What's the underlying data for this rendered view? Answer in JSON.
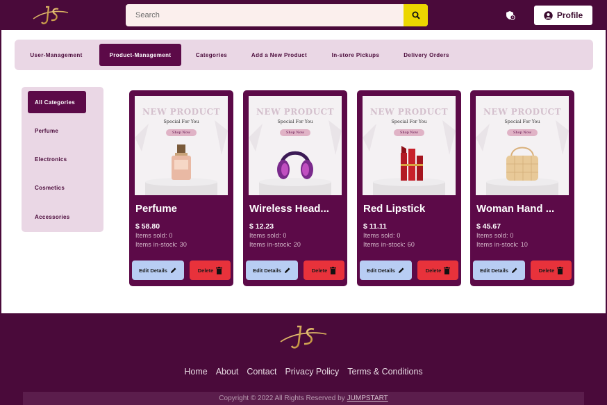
{
  "header": {
    "search_placeholder": "Search",
    "profile_label": "Profile"
  },
  "nav": {
    "tabs": [
      {
        "label": "User-Management",
        "active": false
      },
      {
        "label": "Product-Management",
        "active": true
      },
      {
        "label": "Categories",
        "active": false
      },
      {
        "label": "Add a New Product",
        "active": false
      },
      {
        "label": "In-store Pickups",
        "active": false
      },
      {
        "label": "Delivery Orders",
        "active": false
      }
    ]
  },
  "sidebar": {
    "items": [
      {
        "label": "All Categories",
        "active": true
      },
      {
        "label": "Perfume",
        "active": false
      },
      {
        "label": "Electronics",
        "active": false
      },
      {
        "label": "Cosmetics",
        "active": false
      },
      {
        "label": "Accessories",
        "active": false
      }
    ]
  },
  "product_image": {
    "banner": "NEW PRODUCT",
    "subtitle": "Special For You",
    "pill": "Shop Now"
  },
  "products": [
    {
      "name": "Perfume",
      "price": "$ 58.80",
      "sold": "Items sold: 0",
      "stock": "Items in-stock: 30",
      "icon": "perfume-bottle"
    },
    {
      "name": "Wireless Head...",
      "price": "$ 12.23",
      "sold": "Items sold: 0",
      "stock": "Items in-stock: 20",
      "icon": "headphones"
    },
    {
      "name": "Red Lipstick",
      "price": "$ 11.11",
      "sold": "Items sold: 0",
      "stock": "Items in-stock: 60",
      "icon": "lipstick"
    },
    {
      "name": "Woman Hand ...",
      "price": "$ 45.67",
      "sold": "Items sold: 0",
      "stock": "Items in-stock: 10",
      "icon": "handbag"
    }
  ],
  "card_actions": {
    "edit_label": "Edit Details",
    "delete_label": "Delete"
  },
  "footer": {
    "links": [
      "Home",
      "About",
      "Contact",
      "Privacy Policy",
      "Terms & Conditions"
    ],
    "copyright": "Copyright © 2022 All Rights Reserved by",
    "company": "JUMPSTART"
  },
  "colors": {
    "brand": "#4a0a3a",
    "card": "#5c0a48",
    "panel": "#ead7e5",
    "search_button": "#ecd600",
    "edit_button": "#b8cdf3",
    "delete_button": "#e8323b"
  }
}
